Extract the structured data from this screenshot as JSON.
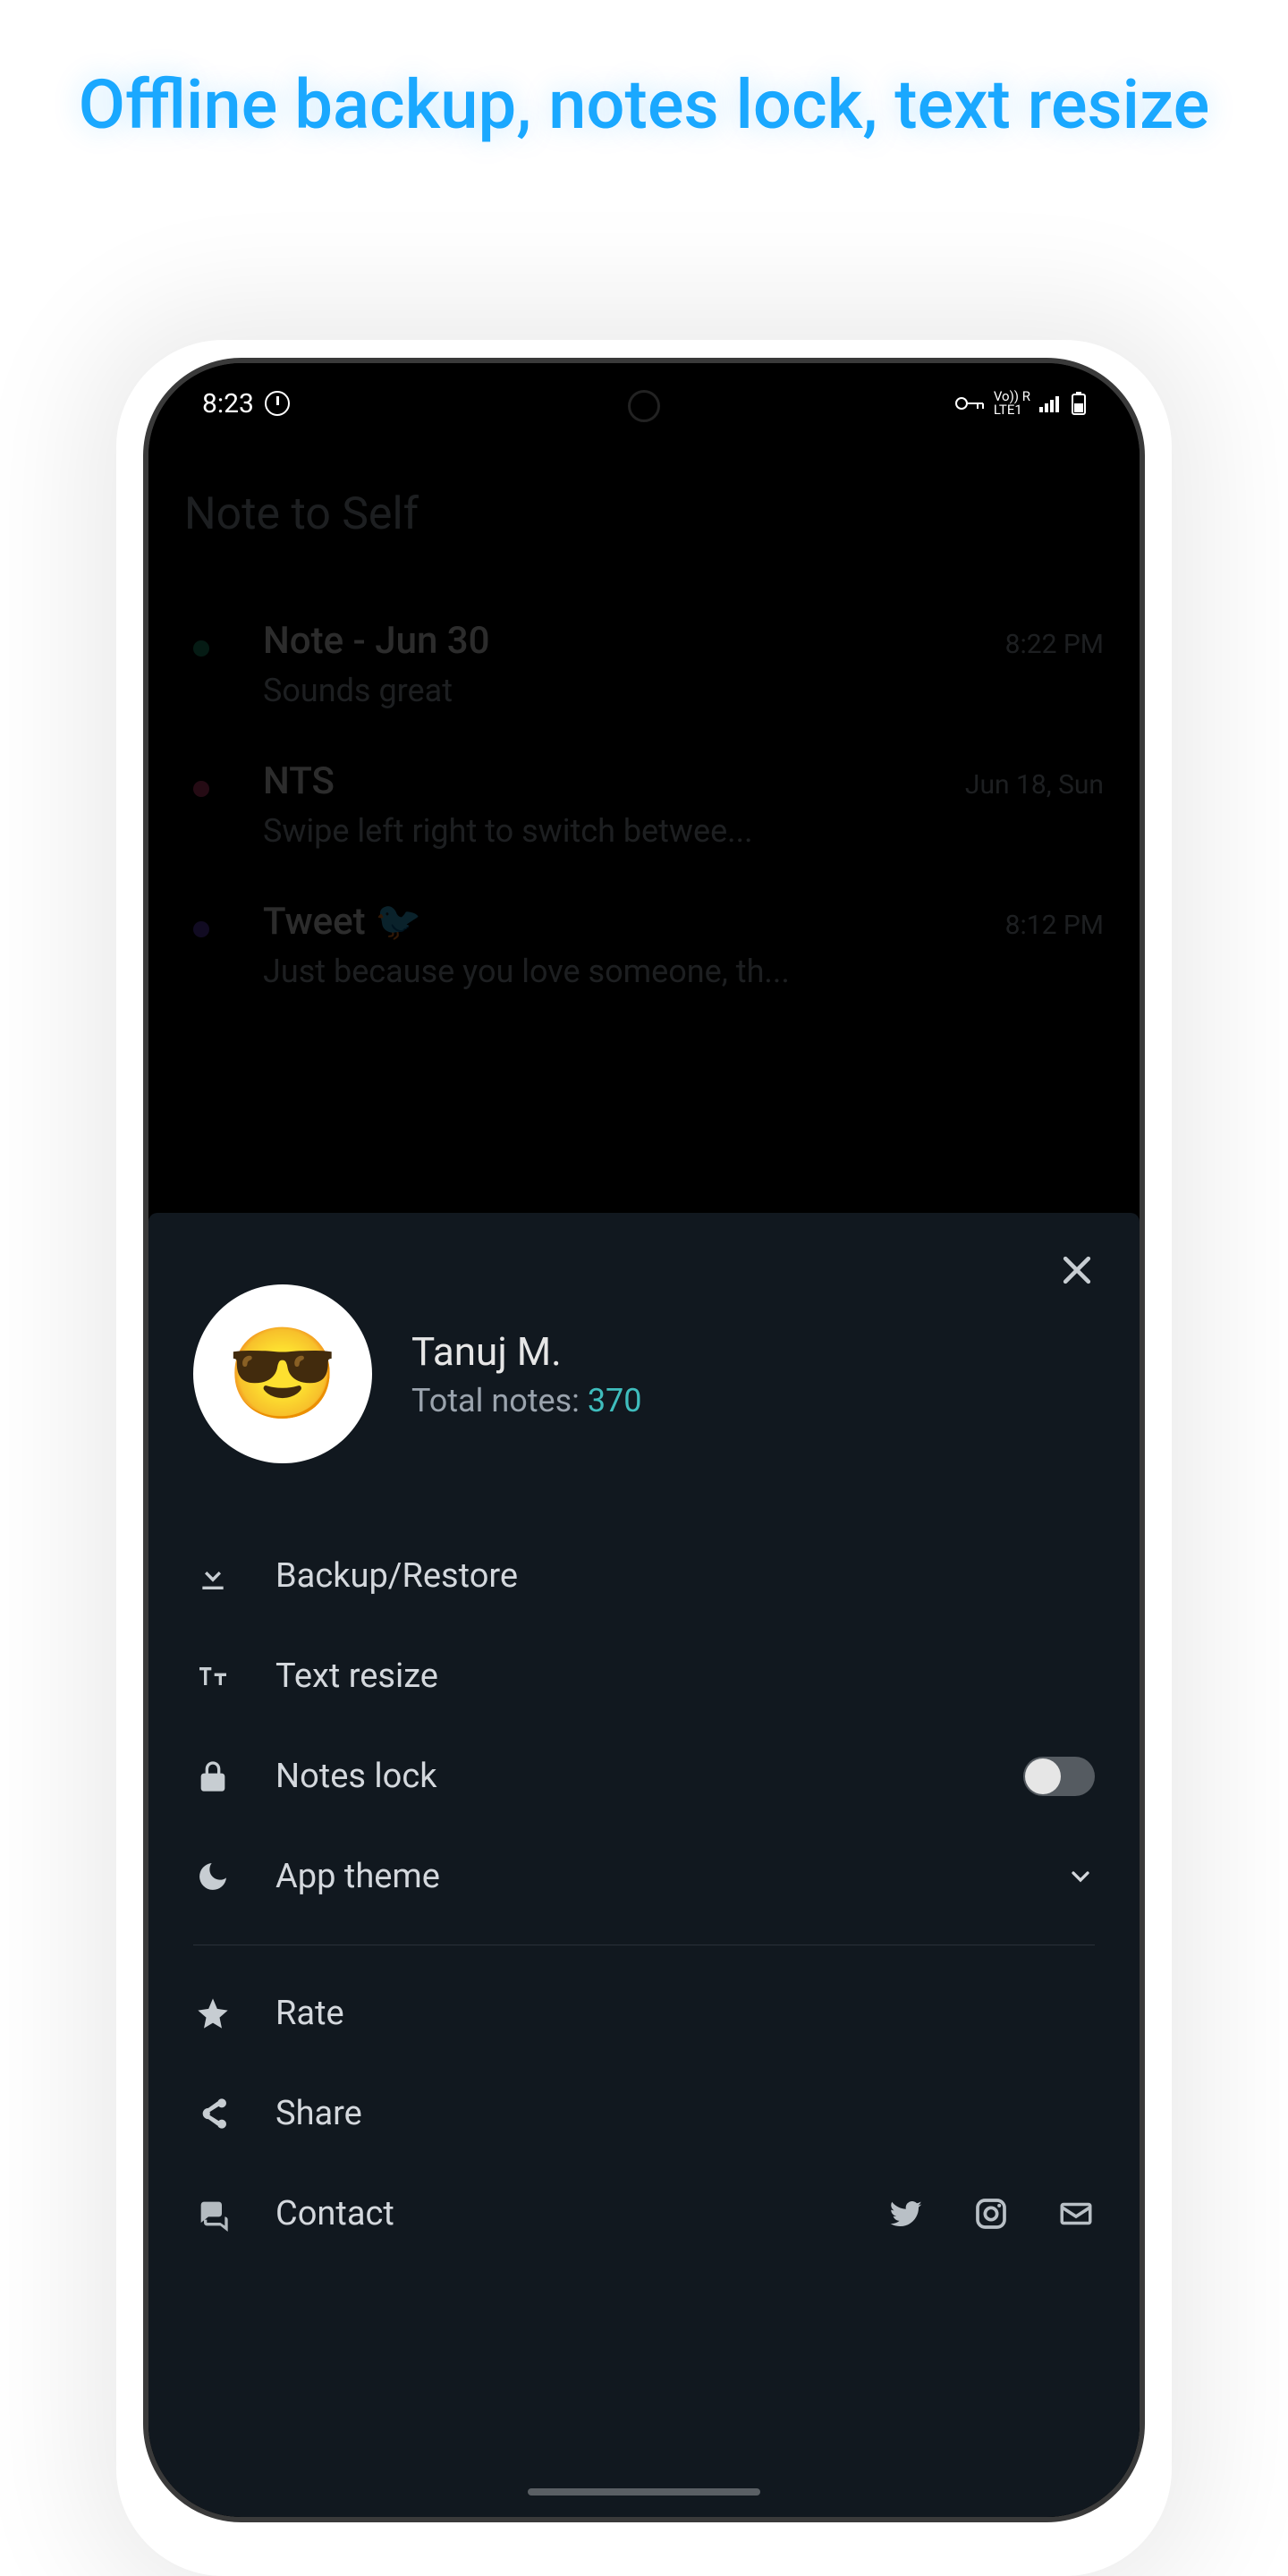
{
  "marketing_headline": "Offline backup, notes lock, text resize",
  "status": {
    "time": "8:23",
    "lte_top": "Vo)) R",
    "lte_bottom": "LTE1"
  },
  "app": {
    "title": "Note to Self",
    "notes": [
      {
        "title": "Note - Jun 30",
        "snippet": "Sounds great",
        "time": "8:22 PM",
        "dot": "#1e8f6a"
      },
      {
        "title": "NTS",
        "snippet": "Swipe left right to switch betwee...",
        "time": "Jun 18, Sun",
        "dot": "#c23d6c"
      },
      {
        "title": "Tweet 🐦",
        "snippet": "Just because you love someone, th...",
        "time": "8:12 PM",
        "dot": "#5a3db3"
      }
    ]
  },
  "sheet": {
    "avatar_emoji": "😎",
    "name": "Tanuj M.",
    "total_notes_label": "Total notes: ",
    "total_notes_value": "370",
    "items": {
      "backup": "Backup/Restore",
      "text_resize": "Text resize",
      "notes_lock": "Notes lock",
      "app_theme": "App theme",
      "rate": "Rate",
      "share": "Share",
      "contact": "Contact"
    }
  }
}
